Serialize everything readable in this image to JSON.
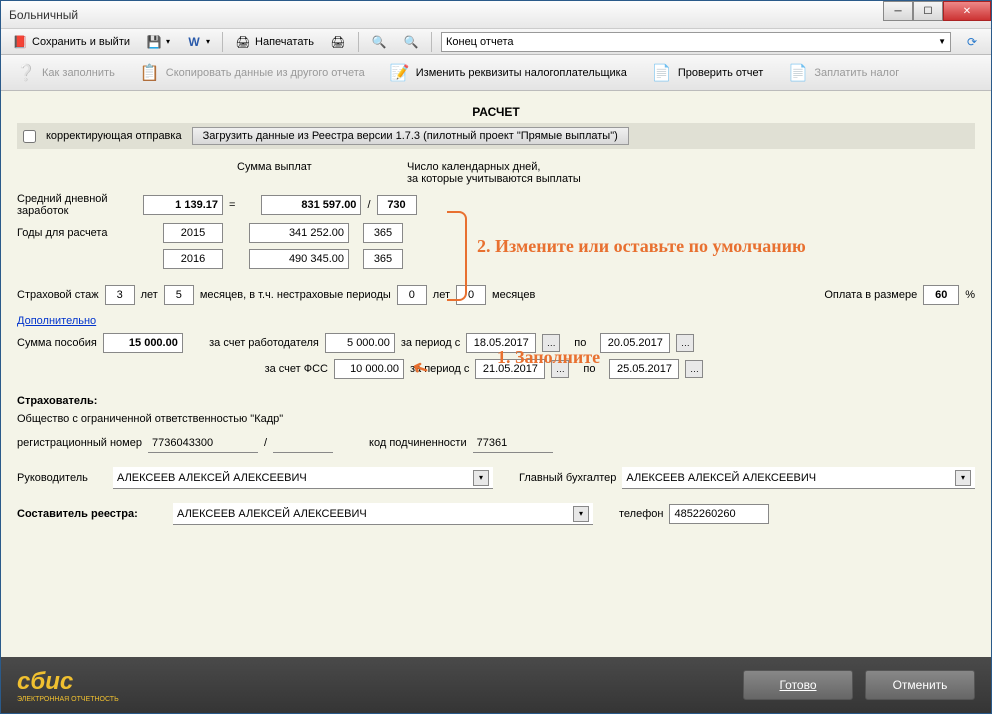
{
  "window": {
    "title": "Больничный"
  },
  "toolbar1": {
    "save_exit": "Сохранить и выйти",
    "print": "Напечатать",
    "dropdown": "Конец отчета"
  },
  "toolbar2": {
    "how_fill": "Как заполнить",
    "copy_data": "Скопировать данные из другого отчета",
    "change_req": "Изменить реквизиты налогоплательщика",
    "check": "Проверить отчет",
    "pay_tax": "Заплатить налог"
  },
  "section": {
    "title": "РАСЧЕТ"
  },
  "correcting": {
    "label": "корректирующая отправка",
    "load_btn": "Загрузить данные из Реестра версии 1.7.3 (пилотный проект \"Прямые выплаты\")"
  },
  "headers": {
    "sum": "Сумма выплат",
    "days": "Число календарных дней,\nза которые учитываются выплаты"
  },
  "avg_daily": {
    "label": "Средний дневной заработок",
    "value": "1 139.17",
    "total_sum": "831 597.00",
    "total_days": "730"
  },
  "years": {
    "label": "Годы для расчета",
    "rows": [
      {
        "year": "2015",
        "sum": "341 252.00",
        "days": "365"
      },
      {
        "year": "2016",
        "sum": "490 345.00",
        "days": "365"
      }
    ]
  },
  "insurance": {
    "label": "Страховой стаж",
    "years": "3",
    "years_lbl": "лет",
    "months": "5",
    "months_lbl": "месяцев, в т.ч. нестраховые периоды",
    "non_years": "0",
    "non_years_lbl": "лет",
    "non_months": "0",
    "non_months_lbl": "месяцев",
    "pay_label": "Оплата в размере",
    "pay_pct": "60",
    "pct": "%"
  },
  "additional": "Дополнительно",
  "benefit": {
    "label": "Сумма пособия",
    "total": "15 000.00",
    "employer_lbl": "за счет работодателя",
    "employer_val": "5 000.00",
    "fss_lbl": "за счет ФСС",
    "fss_val": "10 000.00",
    "period_from": "за период с",
    "period_to": "по",
    "emp_from": "18.05.2017",
    "emp_to": "20.05.2017",
    "fss_from": "21.05.2017",
    "fss_to": "25.05.2017"
  },
  "insurer": {
    "title": "Страхователь:",
    "name": "Общество с ограниченной ответственностью \"Кадр\"",
    "reg_lbl": "регистрационный номер",
    "reg_val": "7736043300",
    "sub_lbl": "код подчиненности",
    "sub_val": "77361"
  },
  "people": {
    "head_lbl": "Руководитель",
    "head_val": "АЛЕКСЕЕВ АЛЕКСЕЙ АЛЕКСЕЕВИЧ",
    "acc_lbl": "Главный бухгалтер",
    "acc_val": "АЛЕКСЕЕВ АЛЕКСЕЙ АЛЕКСЕЕВИЧ",
    "author_lbl": "Составитель реестра:",
    "author_val": "АЛЕКСЕЕВ АЛЕКСЕЙ АЛЕКСЕЕВИЧ",
    "phone_lbl": "телефон",
    "phone_val": "4852260260"
  },
  "annotations": {
    "a1": "1. Заполните",
    "a2": "2. Измените или оставьте по умолчанию"
  },
  "footer": {
    "logo": "сбис",
    "logo_sub": "ЭЛЕКТРОННАЯ ОТЧЕТНОСТЬ",
    "ready": "Готово",
    "cancel": "Отменить"
  }
}
